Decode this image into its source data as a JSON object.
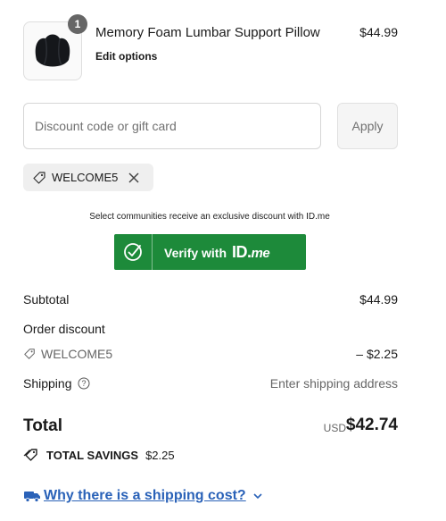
{
  "cart_item": {
    "name": "Memory Foam Lumbar Support Pillow",
    "edit_label": "Edit options",
    "price": "$44.99",
    "quantity": "1"
  },
  "discount": {
    "placeholder": "Discount code or gift card",
    "apply_label": "Apply",
    "applied_code": "WELCOME5"
  },
  "idme": {
    "notice": "Select communities receive an exclusive discount with ID.me",
    "verify_label": "Verify with",
    "logo_id": "ID.",
    "logo_me": "me"
  },
  "summary": {
    "subtotal_label": "Subtotal",
    "subtotal_value": "$44.99",
    "order_discount_label": "Order discount",
    "discount_code": "WELCOME5",
    "discount_value": "– $2.25",
    "shipping_label": "Shipping",
    "shipping_value": "Enter shipping address",
    "total_label": "Total",
    "total_currency": "USD",
    "total_value": "$42.74",
    "savings_label": "TOTAL SAVINGS",
    "savings_value": "$2.25"
  },
  "shipping_link": {
    "label": "Why there is a shipping cost?"
  },
  "colors": {
    "accent_green": "#1d8a3a",
    "link_blue": "#2a62b8"
  }
}
